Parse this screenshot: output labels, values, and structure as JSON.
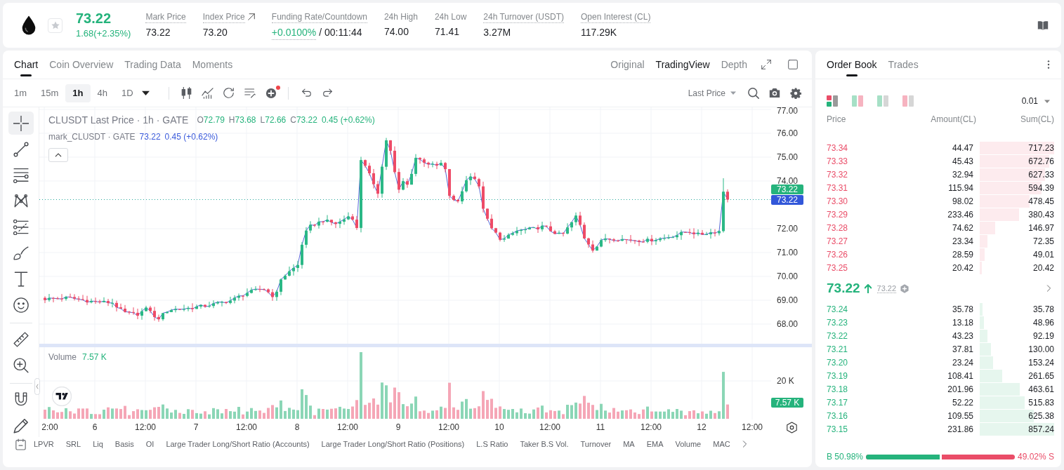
{
  "header": {
    "favorited": false,
    "price": {
      "value": "73.22",
      "change": "1.68(+2.35%)",
      "rising": true
    },
    "stats": [
      {
        "label": "Mark Price",
        "tooltip": true,
        "link": false,
        "value": "73.22",
        "value_tooltip": false,
        "positive": false
      },
      {
        "label": "Index Price",
        "tooltip": true,
        "link": true,
        "value": "73.20",
        "value_tooltip": false,
        "positive": false
      },
      {
        "label": "Funding Rate/Countdown",
        "tooltip": true,
        "link": false,
        "value": "+0.0100%",
        "value_tooltip": true,
        "positive": true,
        "countdown": "/ 00:11:44"
      },
      {
        "label": "24h High",
        "tooltip": false,
        "link": false,
        "value": "74.00",
        "value_tooltip": false,
        "positive": false
      },
      {
        "label": "24h Low",
        "tooltip": false,
        "link": false,
        "value": "71.41",
        "value_tooltip": false,
        "positive": false
      },
      {
        "label": "24h Turnover (USDT)",
        "tooltip": true,
        "link": false,
        "value": "3.27M",
        "value_tooltip": false,
        "positive": false
      },
      {
        "label": "Open Interest (CL)",
        "tooltip": true,
        "link": false,
        "value": "117.29K",
        "value_tooltip": false,
        "positive": false
      }
    ]
  },
  "chart": {
    "tabs": [
      {
        "label": "Chart",
        "selected": true
      },
      {
        "label": "Coin Overview",
        "selected": false
      },
      {
        "label": "Trading Data",
        "selected": false
      },
      {
        "label": "Moments",
        "selected": false
      }
    ],
    "views": [
      {
        "label": "Original",
        "selected": false
      },
      {
        "label": "TradingView",
        "selected": true
      },
      {
        "label": "Depth",
        "selected": false
      }
    ],
    "intervals": [
      {
        "label": "1m",
        "selected": false
      },
      {
        "label": "15m",
        "selected": false
      },
      {
        "label": "1h",
        "selected": true
      },
      {
        "label": "4h",
        "selected": false
      },
      {
        "label": "1D",
        "selected": false
      }
    ],
    "price_source": "Last Price",
    "tool_groups": [
      {
        "tools": [
          {
            "kind": "crosshair",
            "selected": true
          },
          {
            "kind": "trend-line",
            "selected": false
          },
          {
            "kind": "parallel-lines",
            "selected": false
          },
          {
            "kind": "pattern",
            "selected": false
          },
          {
            "kind": "fibonacci",
            "selected": false
          },
          {
            "kind": "brush",
            "selected": false
          },
          {
            "kind": "text",
            "selected": false
          },
          {
            "kind": "emoji",
            "selected": false
          }
        ]
      },
      {
        "tools": [
          {
            "kind": "ruler",
            "selected": false
          },
          {
            "kind": "zoom-in",
            "selected": false
          }
        ]
      },
      {
        "tools": [
          {
            "kind": "magnet",
            "selected": false
          },
          {
            "kind": "pencil",
            "selected": false
          }
        ]
      }
    ],
    "legend": {
      "title": "CLUSDT Last Price · 1h · GATE",
      "ohlc": [
        {
          "key": "O",
          "value": "72.79"
        },
        {
          "key": "H",
          "value": "73.68"
        },
        {
          "key": "L",
          "value": "72.66"
        },
        {
          "key": "C",
          "value": "73.22"
        }
      ],
      "change": "0.45 (+0.62%)",
      "mark_title": "mark_CLUSDT · GATE",
      "mark_price": "73.22",
      "mark_change": "0.45 (+0.62%)"
    },
    "price_axis": [
      "77.00",
      "76.00",
      "75.00",
      "74.00",
      "72.00",
      "71.00",
      "70.00",
      "69.00",
      "68.00"
    ],
    "last_price": "73.22",
    "mark_price": "73.22",
    "volume": {
      "title": "Volume",
      "value": "7.57 K",
      "axis_label": "20 K",
      "last": "7.57 K"
    },
    "time_axis": [
      "2:00",
      "6",
      "12:00",
      "7",
      "12:00",
      "8",
      "12:00",
      "9",
      "12:00",
      "10",
      "12:00",
      "11",
      "12:00",
      "12",
      "12:00"
    ],
    "indicators": [
      "LPVR",
      "SRL",
      "Liq",
      "Basis",
      "OI",
      "Large Trader Long/Short Ratio (Accounts)",
      "Large Trader Long/Short Ratio (Positions)",
      "L.S Ratio",
      "Taker B.S Vol.",
      "Turnover",
      "MA",
      "EMA",
      "Volume",
      "MAC"
    ]
  },
  "orderbook": {
    "tabs": [
      {
        "label": "Order Book",
        "selected": true
      },
      {
        "label": "Trades",
        "selected": false
      }
    ],
    "layouts": [
      {
        "kind": "combined",
        "selected": true
      },
      {
        "kind": "split",
        "selected": false
      },
      {
        "kind": "bids",
        "selected": false
      },
      {
        "kind": "asks",
        "selected": false
      }
    ],
    "precision": "0.01",
    "columns": [
      "Price",
      "Amount(CL)",
      "Sum(CL)"
    ],
    "asks": [
      {
        "price": "73.34",
        "amount": "44.47",
        "sum": "717.23"
      },
      {
        "price": "73.33",
        "amount": "45.43",
        "sum": "672.76"
      },
      {
        "price": "73.32",
        "amount": "32.94",
        "sum": "627.33"
      },
      {
        "price": "73.31",
        "amount": "115.94",
        "sum": "594.39"
      },
      {
        "price": "73.30",
        "amount": "98.02",
        "sum": "478.45"
      },
      {
        "price": "73.29",
        "amount": "233.46",
        "sum": "380.43"
      },
      {
        "price": "73.28",
        "amount": "74.62",
        "sum": "146.97"
      },
      {
        "price": "73.27",
        "amount": "23.34",
        "sum": "72.35"
      },
      {
        "price": "73.26",
        "amount": "28.59",
        "sum": "49.01"
      },
      {
        "price": "73.25",
        "amount": "20.42",
        "sum": "20.42"
      }
    ],
    "mid": {
      "price": "73.22",
      "rising": true,
      "mark": "73.22"
    },
    "bids": [
      {
        "price": "73.24",
        "amount": "35.78",
        "sum": "35.78"
      },
      {
        "price": "73.23",
        "amount": "13.18",
        "sum": "48.96"
      },
      {
        "price": "73.22",
        "amount": "43.23",
        "sum": "92.19"
      },
      {
        "price": "73.21",
        "amount": "37.81",
        "sum": "130.00"
      },
      {
        "price": "73.20",
        "amount": "23.24",
        "sum": "153.24"
      },
      {
        "price": "73.19",
        "amount": "108.41",
        "sum": "261.65"
      },
      {
        "price": "73.18",
        "amount": "201.96",
        "sum": "463.61"
      },
      {
        "price": "73.17",
        "amount": "52.22",
        "sum": "515.83"
      },
      {
        "price": "73.16",
        "amount": "109.55",
        "sum": "625.38"
      },
      {
        "price": "73.15",
        "amount": "231.86",
        "sum": "857.24"
      }
    ],
    "ratio": {
      "buy": "B 50.98%",
      "sell": "49.02% S",
      "level": 0.5098
    }
  }
}
